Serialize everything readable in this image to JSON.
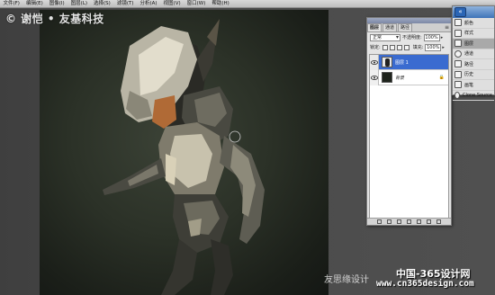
{
  "menu": {
    "items": [
      "文件(F)",
      "编辑(E)",
      "图像(I)",
      "图层(L)",
      "选择(S)",
      "滤镜(T)",
      "分析(A)",
      "视图(V)",
      "窗口(W)",
      "帮助(H)"
    ]
  },
  "watermarks": {
    "top_left": "© 谢恺 • 友基科技",
    "bottom_left": "友思缘设计",
    "bottom_right_line1": "中国-365设计网",
    "bottom_right_line2": "www.cn365design.com"
  },
  "layers_panel": {
    "tabs": [
      "图层",
      "通道",
      "路径"
    ],
    "blend_mode": "正常",
    "opacity_label": "不透明度:",
    "opacity_value": "100%",
    "lock_label": "锁定:",
    "fill_label": "填充:",
    "fill_value": "100%",
    "layers": [
      {
        "name": "图层 1",
        "selected": true,
        "locked": false
      },
      {
        "name": "背景",
        "selected": false,
        "locked": true
      }
    ]
  },
  "dock": {
    "items": [
      {
        "label": "颜色",
        "icon": "color-icon"
      },
      {
        "label": "样式",
        "icon": "styles-icon"
      },
      {
        "label": "图层",
        "icon": "layers-icon",
        "active": true
      },
      {
        "label": "通道",
        "icon": "channels-icon"
      },
      {
        "label": "路径",
        "icon": "paths-icon"
      },
      {
        "label": "历史",
        "icon": "history-icon"
      },
      {
        "label": "画笔",
        "icon": "brush-icon"
      },
      {
        "label": "Clone Source",
        "icon": "clone-source-icon"
      }
    ]
  }
}
